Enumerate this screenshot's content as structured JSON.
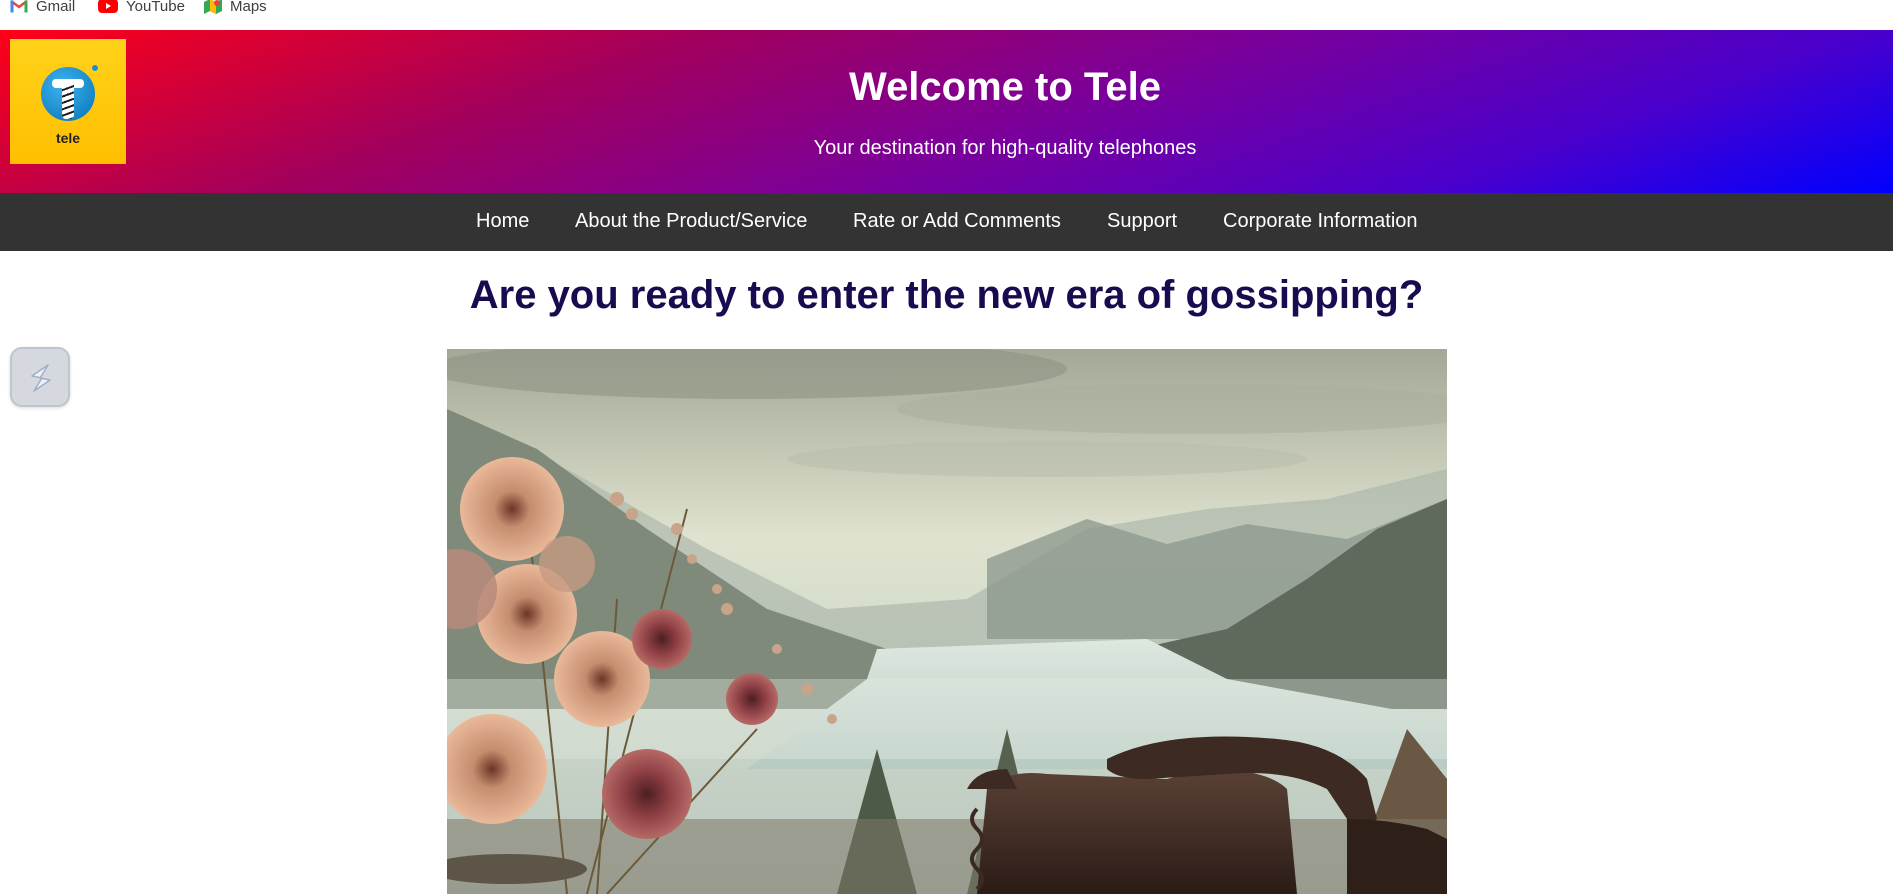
{
  "bookmarks": [
    {
      "label": "Gmail",
      "icon": "gmail-icon"
    },
    {
      "label": "YouTube",
      "icon": "youtube-icon"
    },
    {
      "label": "Maps",
      "icon": "maps-icon"
    }
  ],
  "header": {
    "logo_text": "tele",
    "title": "Welcome to Tele",
    "subtitle": "Your destination for high-quality telephones"
  },
  "nav": {
    "items": [
      {
        "label": "Home"
      },
      {
        "label": "About the Product/Service"
      },
      {
        "label": "Rate or Add Comments"
      },
      {
        "label": "Support"
      },
      {
        "label": "Corporate Information"
      }
    ]
  },
  "main": {
    "headline": "Are you ready to enter the new era of gossipping?"
  },
  "colors": {
    "header_gradient_start": "#ff0016",
    "header_gradient_end": "#0000ff",
    "nav_background": "#333333",
    "headline_color": "#1a0a4f",
    "logo_background": "#ffc400"
  }
}
